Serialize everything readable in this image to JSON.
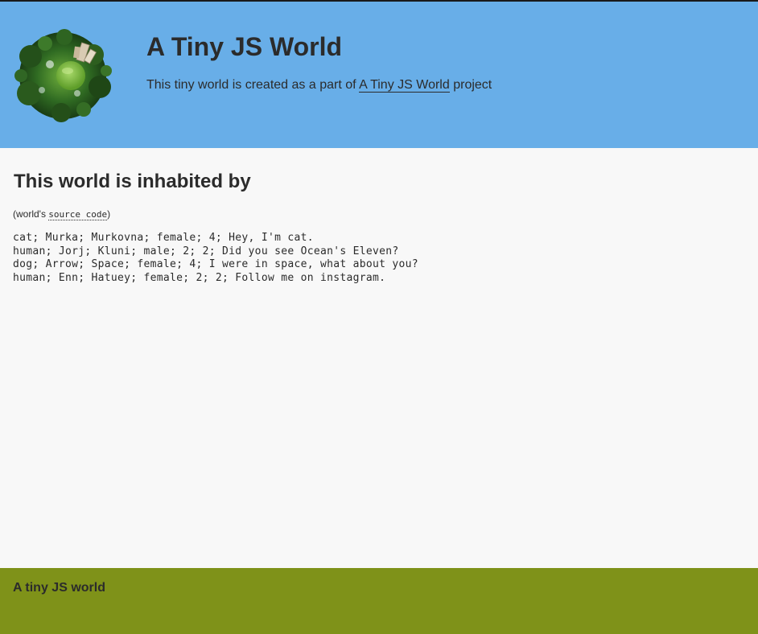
{
  "header": {
    "title": "A Tiny JS World",
    "subtitle_prefix": "This tiny world is created as a part of ",
    "subtitle_link": "A Tiny JS World",
    "subtitle_suffix": " project",
    "logo_icon": "tiny-planet-globe-icon"
  },
  "main": {
    "heading": "This world is inhabited by",
    "source_prefix": "(world's ",
    "source_link": "source code",
    "source_suffix": ")",
    "inhabitants": [
      "cat; Murka; Murkovna; female; 4; Hey, I'm cat.",
      "human; Jorj; Kluni; male; 2; 2; Did you see Ocean's Eleven?",
      "dog; Arrow; Space; female; 4; I were in space, what about you?",
      "human; Enn; Hatuey; female; 2; 2; Follow me on instagram."
    ]
  },
  "footer": {
    "title": "A tiny JS world"
  },
  "colors": {
    "header_bg": "#68aee8",
    "main_bg": "#f8f8f8",
    "footer_bg": "#7f9219",
    "text": "#2b2b2b"
  }
}
